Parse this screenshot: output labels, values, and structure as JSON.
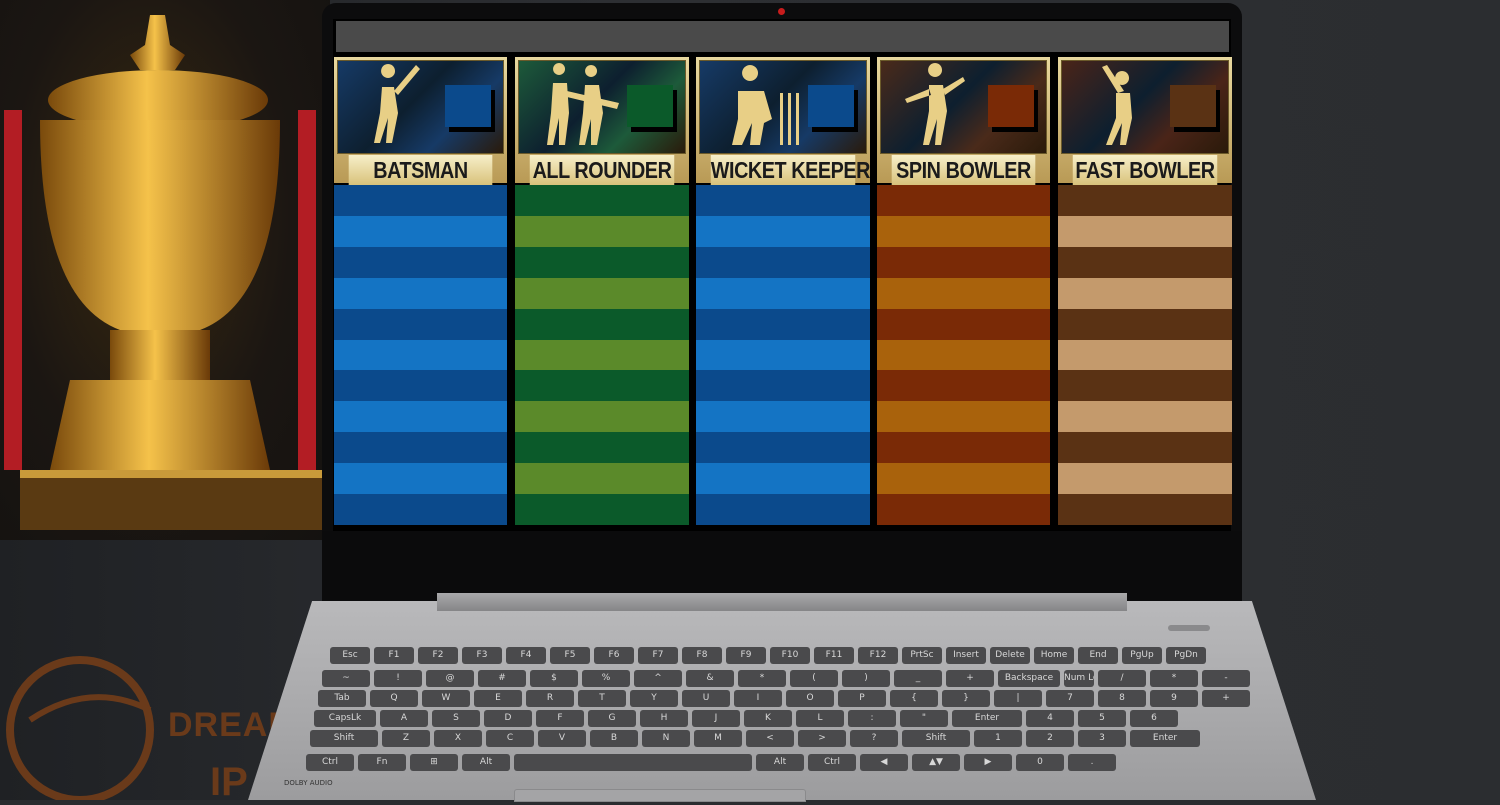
{
  "screen": {
    "columns": [
      {
        "label": "BATSMAN",
        "icon": "batsman-icon",
        "swatch": "#0b4a8c",
        "stripe_a": "#0b4a8c",
        "stripe_b": "#1474c4",
        "header_bg": "#163a66"
      },
      {
        "label": "ALL ROUNDER",
        "icon": "all-rounder-icon",
        "swatch": "#0b5a2a",
        "stripe_a": "#0b5a2a",
        "stripe_b": "#5b8a2a",
        "header_bg": "#1d5a3a"
      },
      {
        "label": "WICKET KEEPER",
        "icon": "wicket-keeper-icon",
        "swatch": "#0b4a8c",
        "stripe_a": "#0b4a8c",
        "stripe_b": "#1474c4",
        "header_bg": "#163a66"
      },
      {
        "label": "SPIN BOWLER",
        "icon": "spin-bowler-icon",
        "swatch": "#7a2a06",
        "stripe_a": "#7a2a06",
        "stripe_b": "#a9620c",
        "header_bg": "#4a2a1a"
      },
      {
        "label": "FAST BOWLER",
        "icon": "fast-bowler-icon",
        "swatch": "#5a3214",
        "stripe_a": "#5a3214",
        "stripe_b": "#c49a6c",
        "header_bg": "#4a2418"
      }
    ]
  },
  "keyboard": {
    "rows": [
      [
        "Esc",
        "F1",
        "F2",
        "F3",
        "F4",
        "F5",
        "F6",
        "F7",
        "F8",
        "F9",
        "F10",
        "F11",
        "F12",
        "PrtSc",
        "Insert",
        "Delete",
        "Home",
        "End",
        "PgUp",
        "PgDn"
      ],
      [
        "~",
        "!",
        "@",
        "#",
        "$",
        "%",
        "^",
        "&",
        "*",
        "(",
        ")",
        "_",
        "+",
        "Backspace",
        "Num Lock",
        "/",
        "*",
        "-"
      ],
      [
        "Tab",
        "Q",
        "W",
        "E",
        "R",
        "T",
        "Y",
        "U",
        "I",
        "O",
        "P",
        "{",
        "}",
        "|",
        "7",
        "8",
        "9",
        "+"
      ],
      [
        "CapsLk",
        "A",
        "S",
        "D",
        "F",
        "G",
        "H",
        "J",
        "K",
        "L",
        ":",
        "\"",
        "Enter",
        "4",
        "5",
        "6"
      ],
      [
        "Shift",
        "Z",
        "X",
        "C",
        "V",
        "B",
        "N",
        "M",
        "<",
        ">",
        "?",
        "Shift",
        "1",
        "2",
        "3",
        "Enter"
      ],
      [
        "Ctrl",
        "Fn",
        "⊞",
        "Alt",
        "",
        "Alt",
        "Ctrl",
        "◀",
        "▲▼",
        "▶",
        "0",
        "."
      ]
    ],
    "dolby_label": "DOLBY AUDIO"
  },
  "backdrop": {
    "brand_text_1": "DREAM",
    "brand_text_2": "IP"
  }
}
